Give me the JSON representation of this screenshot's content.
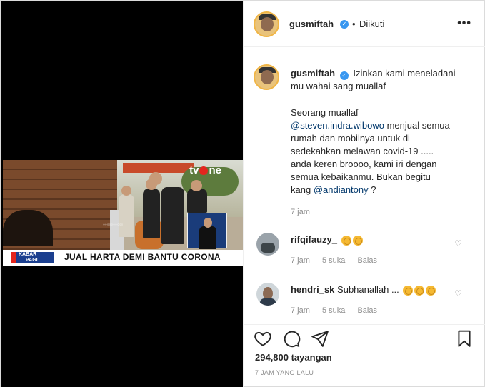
{
  "header": {
    "username": "gusmiftah",
    "separator": "•",
    "follow_state": "Diikuti",
    "more_label": "•••"
  },
  "video": {
    "channel_logo_left": "tv",
    "channel_logo_right": "ne",
    "ticker_brand_top": "KABAR",
    "ticker_brand_bottom": "PAGI",
    "ticker_text": "JUAL HARTA DEMI BANTU CORONA"
  },
  "caption": {
    "username": "gusmiftah",
    "line1": "Izinkan kami meneladani",
    "line2": "mu wahai sang muallaf",
    "p1": "Seorang muallaf",
    "mention1": "@steven.indra.wibowo",
    "p2": " menjual semua",
    "p3": "rumah dan mobilnya untuk di",
    "p4": "sedekahkan melawan covid-19 .....",
    "p5": "anda keren broooo, kami iri dengan",
    "p6": "semua kebaikanmu. Bukan begitu",
    "p7": "kang ",
    "mention2": "@andiantony",
    "p8": " ?",
    "time": "7 jam"
  },
  "comments": [
    {
      "username": "rifqifauzy_",
      "text": "",
      "claps": 2,
      "time": "7 jam",
      "likes": "5 suka",
      "reply": "Balas"
    },
    {
      "username": "hendri_sk",
      "text": "Subhanallah ...",
      "claps": 3,
      "time": "7 jam",
      "likes": "5 suka",
      "reply": "Balas"
    }
  ],
  "footer": {
    "views": "294,800 tayangan",
    "posted": "7 JAM YANG LALU"
  },
  "icons": [
    "heart-icon",
    "comment-icon",
    "share-icon",
    "bookmark-icon",
    "verified-icon",
    "more-icon"
  ],
  "colors": {
    "mention": "#00376b",
    "verified": "#3897f0",
    "muted": "#8e8e8e"
  }
}
